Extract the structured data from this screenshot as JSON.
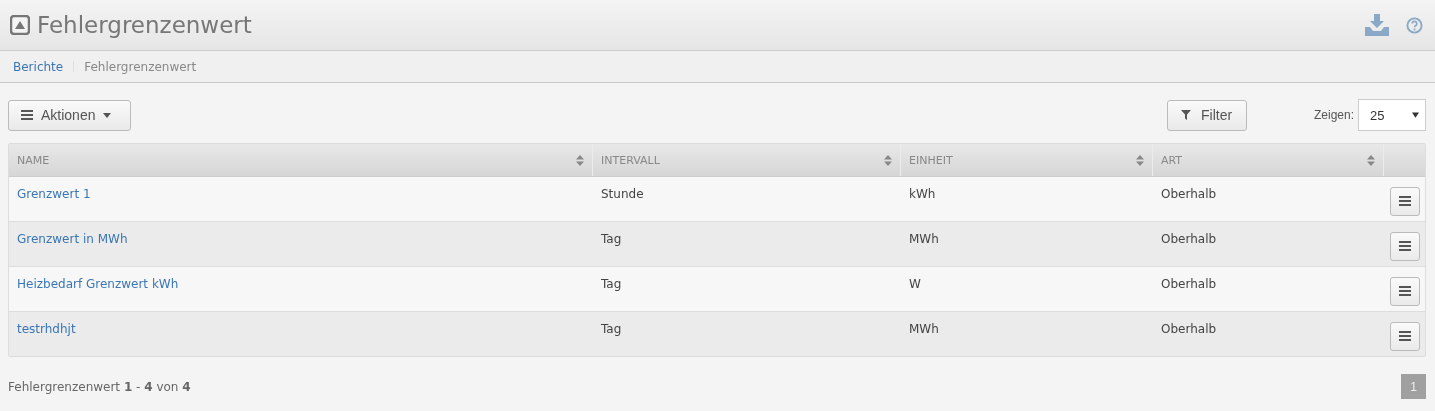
{
  "header": {
    "title": "Fehlergrenzenwert"
  },
  "breadcrumb": [
    {
      "label": "Berichte",
      "link": true
    },
    {
      "label": "Fehlergrenzenwert",
      "link": false
    }
  ],
  "toolbar": {
    "actions": "Aktionen",
    "filter": "Filter",
    "show_label": "Zeigen:",
    "page_size": "25"
  },
  "table": {
    "columns": [
      "NAME",
      "INTERVALL",
      "EINHEIT",
      "ART"
    ],
    "rows": [
      {
        "cells": [
          "Grenzwert 1",
          "Stunde",
          "kWh",
          "Oberhalb"
        ]
      },
      {
        "cells": [
          "Grenzwert in MWh",
          "Tag",
          "MWh",
          "Oberhalb"
        ]
      },
      {
        "cells": [
          "Heizbedarf Grenzwert kWh",
          "Tag",
          "W",
          "Oberhalb"
        ]
      },
      {
        "cells": [
          "testrhdhjt",
          "Tag",
          "MWh",
          "Oberhalb"
        ]
      }
    ]
  },
  "footer": {
    "summary": "Fehlergrenzenwert **1** - **4** von **4**",
    "pages": [
      {
        "label": "1",
        "selected": true
      }
    ]
  }
}
